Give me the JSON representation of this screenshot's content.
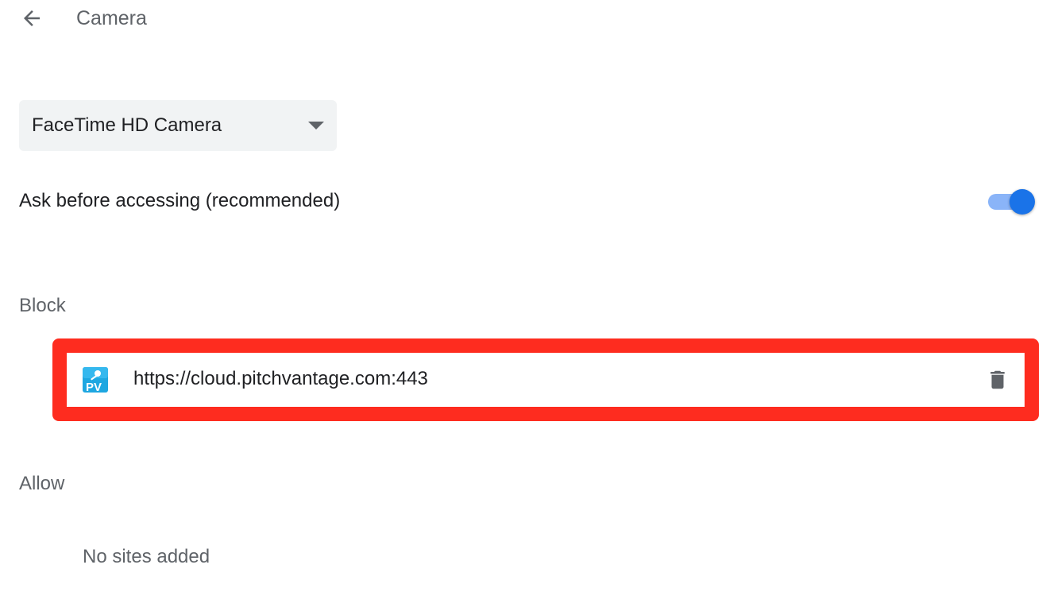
{
  "header": {
    "title": "Camera",
    "back_icon": "arrow-back-icon"
  },
  "device_select": {
    "selected": "FaceTime HD Camera",
    "icon": "chevron-down-icon"
  },
  "ask_setting": {
    "label": "Ask before accessing (recommended)",
    "enabled": true
  },
  "block": {
    "heading": "Block",
    "sites": [
      {
        "url": "https://cloud.pitchvantage.com:443",
        "favicon": "pv-favicon-icon",
        "action_icon": "trash-icon"
      }
    ]
  },
  "allow": {
    "heading": "Allow",
    "empty_text": "No sites added"
  },
  "colors": {
    "accent": "#1a73e8",
    "toggle_track": "#8ab4f8",
    "highlight": "#fe2c1f",
    "select_bg": "#f1f3f4",
    "muted_text": "#5f6368"
  }
}
